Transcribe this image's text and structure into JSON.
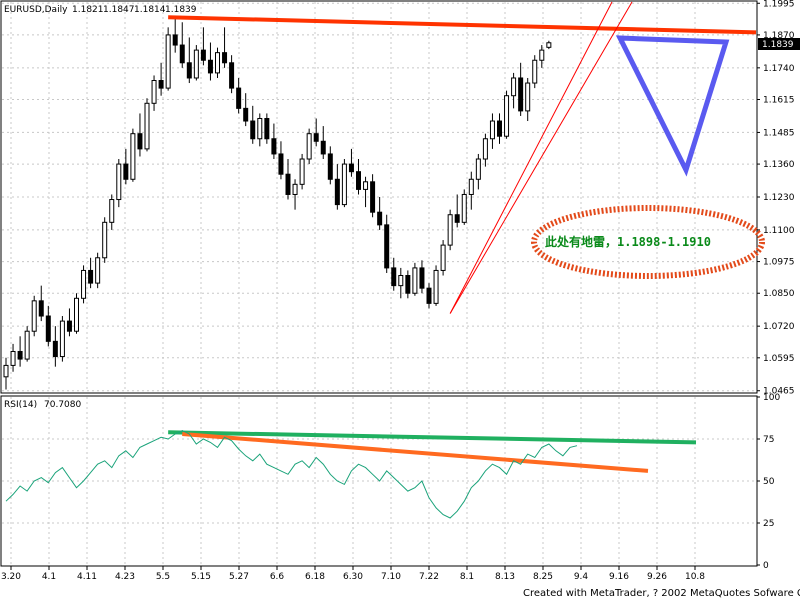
{
  "chart_data": [
    {
      "type": "candlestick",
      "title": "EURUSD,Daily",
      "ohlc_readout": [
        "1.1821",
        "1.1847",
        "1.1814",
        "1.1839"
      ],
      "current_price": "1.1839",
      "ylim": [
        1.046,
        1.2
      ],
      "y_ticks": [
        "1.1995",
        "1.1870",
        "1.1740",
        "1.1615",
        "1.1485",
        "1.1360",
        "1.1230",
        "1.1100",
        "1.0975",
        "1.0850",
        "1.0720",
        "1.0595",
        "1.0465"
      ],
      "x_ticks": [
        "3.20",
        "4.1",
        "4.11",
        "4.23",
        "5.5",
        "5.15",
        "5.27",
        "6.6",
        "6.18",
        "6.30",
        "7.10",
        "7.22",
        "8.1",
        "8.13",
        "8.25",
        "9.4",
        "9.16",
        "9.26",
        "10.8"
      ],
      "candles": [
        {
          "o": 1.052,
          "h": 1.0595,
          "l": 1.047,
          "c": 1.0565
        },
        {
          "o": 1.0565,
          "h": 1.065,
          "l": 1.054,
          "c": 1.062
        },
        {
          "o": 1.062,
          "h": 1.068,
          "l": 1.056,
          "c": 1.059
        },
        {
          "o": 1.059,
          "h": 1.072,
          "l": 1.058,
          "c": 1.07
        },
        {
          "o": 1.07,
          "h": 1.084,
          "l": 1.068,
          "c": 1.082
        },
        {
          "o": 1.082,
          "h": 1.088,
          "l": 1.074,
          "c": 1.076
        },
        {
          "o": 1.076,
          "h": 1.08,
          "l": 1.064,
          "c": 1.066
        },
        {
          "o": 1.066,
          "h": 1.072,
          "l": 1.056,
          "c": 1.06
        },
        {
          "o": 1.06,
          "h": 1.076,
          "l": 1.058,
          "c": 1.074
        },
        {
          "o": 1.074,
          "h": 1.079,
          "l": 1.068,
          "c": 1.07
        },
        {
          "o": 1.07,
          "h": 1.085,
          "l": 1.069,
          "c": 1.083
        },
        {
          "o": 1.083,
          "h": 1.096,
          "l": 1.081,
          "c": 1.094
        },
        {
          "o": 1.094,
          "h": 1.099,
          "l": 1.087,
          "c": 1.089
        },
        {
          "o": 1.089,
          "h": 1.101,
          "l": 1.087,
          "c": 1.099
        },
        {
          "o": 1.099,
          "h": 1.115,
          "l": 1.097,
          "c": 1.113
        },
        {
          "o": 1.113,
          "h": 1.124,
          "l": 1.11,
          "c": 1.122
        },
        {
          "o": 1.122,
          "h": 1.138,
          "l": 1.119,
          "c": 1.136
        },
        {
          "o": 1.136,
          "h": 1.142,
          "l": 1.128,
          "c": 1.13
        },
        {
          "o": 1.13,
          "h": 1.15,
          "l": 1.129,
          "c": 1.148
        },
        {
          "o": 1.148,
          "h": 1.156,
          "l": 1.139,
          "c": 1.142
        },
        {
          "o": 1.142,
          "h": 1.162,
          "l": 1.141,
          "c": 1.16
        },
        {
          "o": 1.16,
          "h": 1.171,
          "l": 1.157,
          "c": 1.169
        },
        {
          "o": 1.169,
          "h": 1.176,
          "l": 1.163,
          "c": 1.166
        },
        {
          "o": 1.166,
          "h": 1.19,
          "l": 1.165,
          "c": 1.187
        },
        {
          "o": 1.187,
          "h": 1.194,
          "l": 1.18,
          "c": 1.183
        },
        {
          "o": 1.183,
          "h": 1.192,
          "l": 1.174,
          "c": 1.176
        },
        {
          "o": 1.176,
          "h": 1.186,
          "l": 1.168,
          "c": 1.17
        },
        {
          "o": 1.17,
          "h": 1.183,
          "l": 1.169,
          "c": 1.181
        },
        {
          "o": 1.181,
          "h": 1.19,
          "l": 1.175,
          "c": 1.177
        },
        {
          "o": 1.177,
          "h": 1.184,
          "l": 1.169,
          "c": 1.172
        },
        {
          "o": 1.172,
          "h": 1.182,
          "l": 1.17,
          "c": 1.18
        },
        {
          "o": 1.18,
          "h": 1.19,
          "l": 1.174,
          "c": 1.176
        },
        {
          "o": 1.176,
          "h": 1.179,
          "l": 1.164,
          "c": 1.166
        },
        {
          "o": 1.166,
          "h": 1.17,
          "l": 1.156,
          "c": 1.158
        },
        {
          "o": 1.158,
          "h": 1.164,
          "l": 1.151,
          "c": 1.153
        },
        {
          "o": 1.153,
          "h": 1.159,
          "l": 1.144,
          "c": 1.146
        },
        {
          "o": 1.146,
          "h": 1.156,
          "l": 1.143,
          "c": 1.154
        },
        {
          "o": 1.154,
          "h": 1.156,
          "l": 1.144,
          "c": 1.146
        },
        {
          "o": 1.146,
          "h": 1.152,
          "l": 1.138,
          "c": 1.14
        },
        {
          "o": 1.14,
          "h": 1.145,
          "l": 1.13,
          "c": 1.132
        },
        {
          "o": 1.132,
          "h": 1.138,
          "l": 1.122,
          "c": 1.124
        },
        {
          "o": 1.124,
          "h": 1.13,
          "l": 1.118,
          "c": 1.128
        },
        {
          "o": 1.128,
          "h": 1.14,
          "l": 1.126,
          "c": 1.138
        },
        {
          "o": 1.138,
          "h": 1.15,
          "l": 1.136,
          "c": 1.148
        },
        {
          "o": 1.148,
          "h": 1.154,
          "l": 1.143,
          "c": 1.145
        },
        {
          "o": 1.145,
          "h": 1.151,
          "l": 1.138,
          "c": 1.14
        },
        {
          "o": 1.14,
          "h": 1.143,
          "l": 1.128,
          "c": 1.13
        },
        {
          "o": 1.13,
          "h": 1.136,
          "l": 1.118,
          "c": 1.12
        },
        {
          "o": 1.12,
          "h": 1.138,
          "l": 1.119,
          "c": 1.136
        },
        {
          "o": 1.136,
          "h": 1.142,
          "l": 1.131,
          "c": 1.133
        },
        {
          "o": 1.133,
          "h": 1.138,
          "l": 1.124,
          "c": 1.126
        },
        {
          "o": 1.126,
          "h": 1.131,
          "l": 1.119,
          "c": 1.129
        },
        {
          "o": 1.129,
          "h": 1.132,
          "l": 1.115,
          "c": 1.117
        },
        {
          "o": 1.117,
          "h": 1.123,
          "l": 1.11,
          "c": 1.112
        },
        {
          "o": 1.112,
          "h": 1.116,
          "l": 1.093,
          "c": 1.095
        },
        {
          "o": 1.095,
          "h": 1.099,
          "l": 1.086,
          "c": 1.088
        },
        {
          "o": 1.088,
          "h": 1.095,
          "l": 1.083,
          "c": 1.092
        },
        {
          "o": 1.092,
          "h": 1.094,
          "l": 1.083,
          "c": 1.085
        },
        {
          "o": 1.085,
          "h": 1.097,
          "l": 1.084,
          "c": 1.095
        },
        {
          "o": 1.095,
          "h": 1.098,
          "l": 1.085,
          "c": 1.087
        },
        {
          "o": 1.087,
          "h": 1.089,
          "l": 1.079,
          "c": 1.081
        },
        {
          "o": 1.081,
          "h": 1.096,
          "l": 1.08,
          "c": 1.094
        },
        {
          "o": 1.094,
          "h": 1.106,
          "l": 1.092,
          "c": 1.104
        },
        {
          "o": 1.104,
          "h": 1.118,
          "l": 1.102,
          "c": 1.116
        },
        {
          "o": 1.116,
          "h": 1.124,
          "l": 1.111,
          "c": 1.113
        },
        {
          "o": 1.113,
          "h": 1.126,
          "l": 1.112,
          "c": 1.124
        },
        {
          "o": 1.124,
          "h": 1.133,
          "l": 1.118,
          "c": 1.13
        },
        {
          "o": 1.13,
          "h": 1.14,
          "l": 1.126,
          "c": 1.138
        },
        {
          "o": 1.138,
          "h": 1.148,
          "l": 1.135,
          "c": 1.146
        },
        {
          "o": 1.146,
          "h": 1.156,
          "l": 1.142,
          "c": 1.153
        },
        {
          "o": 1.153,
          "h": 1.156,
          "l": 1.144,
          "c": 1.147
        },
        {
          "o": 1.147,
          "h": 1.165,
          "l": 1.146,
          "c": 1.163
        },
        {
          "o": 1.163,
          "h": 1.172,
          "l": 1.158,
          "c": 1.17
        },
        {
          "o": 1.17,
          "h": 1.176,
          "l": 1.155,
          "c": 1.157
        },
        {
          "o": 1.157,
          "h": 1.17,
          "l": 1.153,
          "c": 1.168
        },
        {
          "o": 1.168,
          "h": 1.179,
          "l": 1.166,
          "c": 1.177
        },
        {
          "o": 1.177,
          "h": 1.183,
          "l": 1.174,
          "c": 1.181
        },
        {
          "o": 1.1821,
          "h": 1.1847,
          "l": 1.1814,
          "c": 1.1839
        }
      ],
      "trendlines": [
        {
          "name": "resistance",
          "color": "#ff3300",
          "from": {
            "bar": 23,
            "price": 1.194
          },
          "to": {
            "bar": "right-edge",
            "price": 1.188
          }
        },
        {
          "name": "support-a",
          "color": "#ff0000",
          "from": {
            "bar": 63,
            "price": 1.077
          },
          "to": {
            "bar": "top-edge",
            "price": 1.2
          }
        },
        {
          "name": "support-b",
          "color": "#ff0000",
          "from": {
            "bar": 63,
            "price": 1.077
          },
          "to": {
            "bar": "top-edge",
            "price": 1.2
          }
        }
      ],
      "annotation": {
        "text": "此处有地雷，1.1898-1.1910",
        "ellipse_color": "#e34a1a",
        "text_color": "#0a8a1a"
      },
      "shape": {
        "type": "inverted-triangle",
        "color": "#5a5af0"
      }
    },
    {
      "type": "line",
      "title": "RSI(14)",
      "value": "70.7080",
      "ylim": [
        0,
        100
      ],
      "y_ticks": [
        "100",
        "75",
        "50",
        "25",
        "0"
      ],
      "series": [
        {
          "color": "#1aa37a",
          "values": [
            38,
            42,
            47,
            44,
            50,
            52,
            49,
            55,
            58,
            52,
            46,
            50,
            55,
            60,
            62,
            58,
            65,
            68,
            64,
            70,
            72,
            74,
            76,
            75,
            78,
            80,
            78,
            72,
            75,
            73,
            70,
            76,
            74,
            69,
            65,
            62,
            66,
            60,
            58,
            56,
            54,
            60,
            62,
            58,
            64,
            60,
            54,
            50,
            48,
            56,
            60,
            58,
            54,
            50,
            56,
            52,
            48,
            44,
            46,
            50,
            40,
            34,
            30,
            28,
            32,
            38,
            46,
            50,
            56,
            60,
            58,
            54,
            62,
            60,
            66,
            64,
            70,
            72,
            68,
            65,
            70,
            71
          ]
        }
      ],
      "trendlines": [
        {
          "name": "rsi-resistance-green",
          "color": "#20b060",
          "from": {
            "bar": 23,
            "value": 79
          },
          "to": {
            "bar": "right-edge",
            "value": 73
          }
        },
        {
          "name": "rsi-resistance-orange",
          "color": "#ff6a20",
          "from": {
            "bar": 25,
            "value": 78
          },
          "to": {
            "bar": "right-edge",
            "value": 56
          }
        }
      ]
    }
  ],
  "footer": "Created with MetaTrader, ? 2002 MetaQuotes Sofware Corp."
}
